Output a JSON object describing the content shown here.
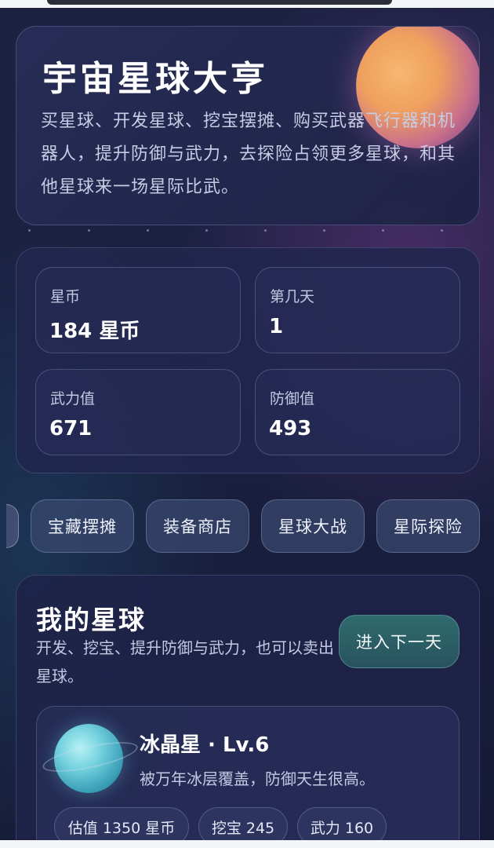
{
  "hero": {
    "title": "宇宙星球大亨",
    "description": "买星球、开发星球、挖宝摆摊、购买武器飞行器和机器人，提升防御与武力，去探险占领更多星球，和其他星球来一场星际比武。"
  },
  "stats": [
    {
      "label": "星币",
      "value": "184 星币"
    },
    {
      "label": "第几天",
      "value": "1"
    },
    {
      "label": "武力值",
      "value": "671"
    },
    {
      "label": "防御值",
      "value": "493"
    }
  ],
  "tabs": [
    "宝藏摆摊",
    "装备商店",
    "星球大战",
    "星际探险"
  ],
  "my_planets": {
    "title": "我的星球",
    "description": "开发、挖宝、提升防御与武力，也可以卖出星球。",
    "next_day_label": "进入下一天",
    "planet": {
      "name": "冰晶星 · Lv.6",
      "description": "被万年冰层覆盖，防御天生很高。",
      "chips": [
        "估值 1350 星币",
        "挖宝 245",
        "武力 160"
      ]
    }
  },
  "colors": {
    "background": "#1b2040",
    "accent_button": "#2f6a6e",
    "tab_bg": "#38486e"
  },
  "icons": {
    "hero_decoration": "orange-planet-icon",
    "planet_avatar": "ice-planet-icon"
  }
}
